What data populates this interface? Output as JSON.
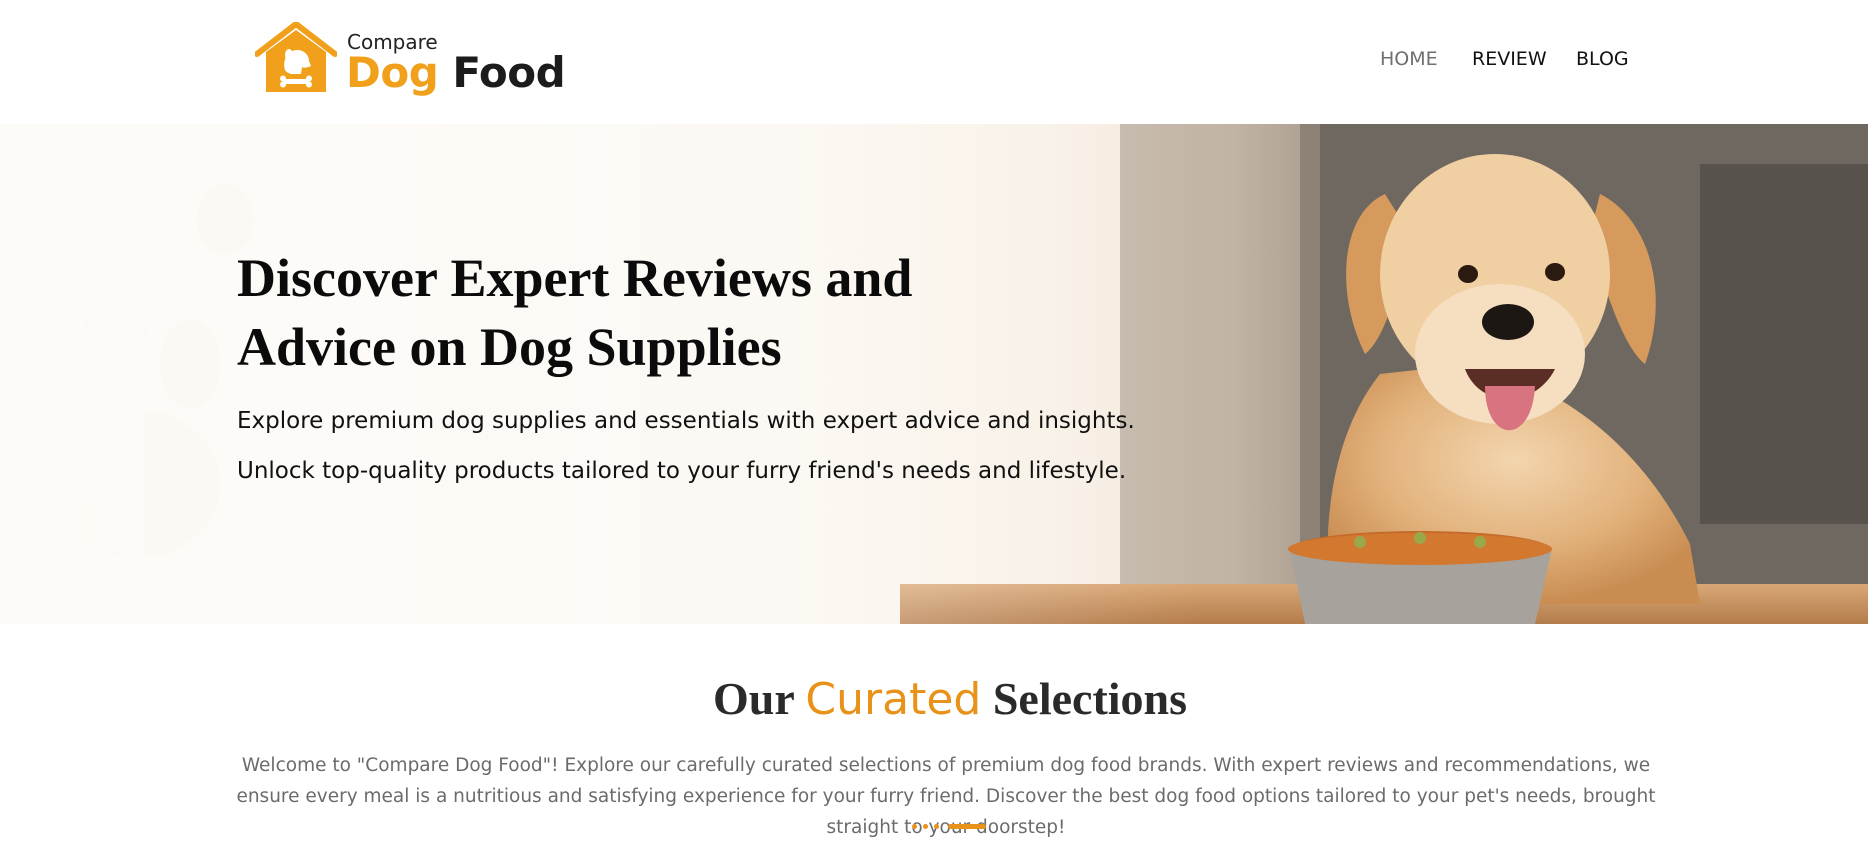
{
  "brand": {
    "small_text": "Compare",
    "dog_text": "Dog",
    "food_text": "Food",
    "colors": {
      "accent": "#f0a01b",
      "dark": "#1c1c1c"
    },
    "icon": "dog-house-icon"
  },
  "nav": {
    "items": [
      {
        "label": "HOME",
        "active": true
      },
      {
        "label": "REVIEW",
        "active": false
      },
      {
        "label": "BLOG",
        "active": false
      }
    ]
  },
  "hero": {
    "title_line1": "Discover Expert Reviews and",
    "title_line2": "Advice on Dog Supplies",
    "sub1": "Explore premium dog supplies and essentials with expert advice and insights.",
    "sub2": "Unlock top-quality products tailored to your furry friend's needs and lifestyle.",
    "image": "golden-retriever-with-food-bowl"
  },
  "section": {
    "title_part1": "Our",
    "title_accent": "Curated",
    "title_part2": "Selections",
    "description": "Welcome to \"Compare Dog Food\"! Explore our carefully curated selections of premium dog food brands. With expert reviews and recommendations, we ensure every meal is a nutritious and satisfying experience for your furry friend. Discover the best dog food options tailored to your pet's needs, brought straight to your doorstep!",
    "accent_color": "#e8921a"
  }
}
